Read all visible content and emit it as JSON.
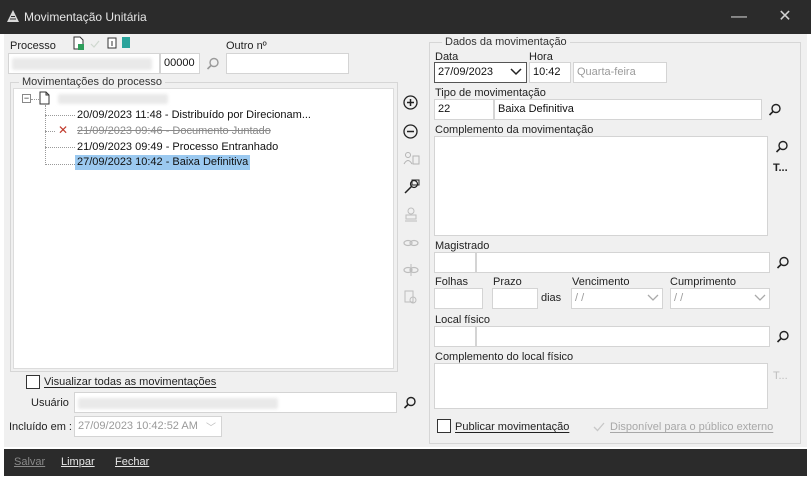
{
  "window": {
    "title": "Movimentação Unitária",
    "minimize_glyph": "—",
    "close_glyph": "✕"
  },
  "left": {
    "processo_label": "Processo",
    "processo_number_suffix": "00000",
    "outro_label": "Outro nº",
    "outro_value": "",
    "movimentacoes_label": "Movimentações do processo",
    "tree": {
      "items": [
        {
          "text": "20/09/2023 11:48 - Distribuído por Direcionam...",
          "state": "normal"
        },
        {
          "text": "21/09/2023 09:46 - Documento Juntado",
          "state": "deleted"
        },
        {
          "text": "21/09/2023 09:49 - Processo Entranhado",
          "state": "normal"
        },
        {
          "text": "27/09/2023 10:42 - Baixa Definitiva",
          "state": "selected"
        }
      ]
    },
    "visualizar_label": "Visualizar todas as movimentações",
    "visualizar_checked": false,
    "usuario_label": "Usuário",
    "incluido_label": "Incluído em :",
    "incluido_value": "27/09/2023 10:42:52 AM"
  },
  "right": {
    "group_title": "Dados da movimentação",
    "data_label": "Data",
    "data_value": "27/09/2023",
    "hora_label": "Hora",
    "hora_value": "10:42",
    "weekday_value": "Quarta-feira",
    "tipo_label": "Tipo de movimentação",
    "tipo_code": "22",
    "tipo_desc": "Baixa Definitiva",
    "complemento_label": "Complemento da movimentação",
    "complemento_value": "",
    "complemento_t": "T...",
    "magistrado_label": "Magistrado",
    "folhas_label": "Folhas",
    "prazo_label": "Prazo",
    "dias_label": "dias",
    "vencimento_label": "Vencimento",
    "vencimento_value": " / /",
    "cumprimento_label": "Cumprimento",
    "cumprimento_value": " / /",
    "local_label": "Local físico",
    "complemento_local_label": "Complemento do local físico",
    "complemento_local_t": "T...",
    "publicar_label": "Publicar movimentação",
    "publicar_checked": false,
    "disponivel_label": "Disponível para o público externo"
  },
  "footer": {
    "salvar": "Salvar",
    "limpar": "Limpar",
    "fechar": "Fechar"
  },
  "colors": {
    "titlebar": "#2b2b2b",
    "selection": "#9bc9f0",
    "deleted_x": "#c0392b",
    "doc_green": "#2e9e5b",
    "teal": "#2aa39b"
  }
}
